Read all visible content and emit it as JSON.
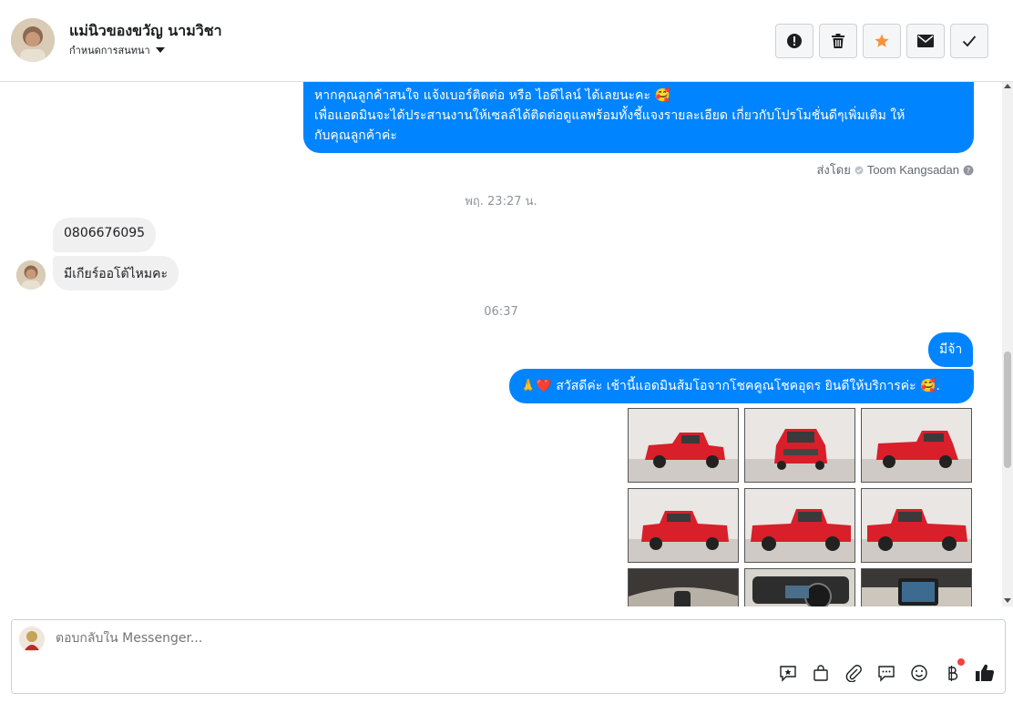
{
  "header": {
    "contact_name": "แม่นิวของขวัญ นามวิชา",
    "assign_label": "กำหนดการสนทนา"
  },
  "icons": {
    "mark_spam": "exclamation-icon",
    "delete": "trash-icon",
    "star": "star-icon",
    "mark_unread": "envelope-icon",
    "done": "checkmark-icon"
  },
  "colors": {
    "outgoing_bubble": "#0084ff",
    "incoming_bubble": "#f1f0f0",
    "star": "#f7923a"
  },
  "messages": {
    "msg1_line1": "หากคุณลูกค้าสนใจ แจ้งเบอร์ติดต่อ หรือ ไอดีไลน์ ได้เลยนะคะ 🥰",
    "msg1_line2": "เพื่อแอดมินจะได้ประสานงานให้เซลล์ได้ติดต่อดูแลพร้อมทั้งชี้แจงรายละเอียด เกี่ยวกับโปรโมชั่นดีๆเพิ่มเติม ให้",
    "msg1_line3": "กับคุณลูกค้าค่ะ",
    "sent_by_label": "ส่งโดย",
    "sent_by_name": "Toom Kangsadan",
    "time1": "พฤ. 23:27 น.",
    "in1": "0806676095",
    "in2": "มีเกียร์ออโต้ไหมคะ",
    "time2": "06:37",
    "out1": "มีจ้า",
    "out2": "🙏❤️ สวัสดีค่ะ เช้านี้แอดมินส้มโอจากโชคคูณโชคอุดร ยินดีให้บริการค่ะ  🥰."
  },
  "photos": [
    {
      "alt": "red pickup front-left"
    },
    {
      "alt": "red pickup front"
    },
    {
      "alt": "red pickup rear-right"
    },
    {
      "alt": "red pickup rear-left"
    },
    {
      "alt": "red pickup side right"
    },
    {
      "alt": "red pickup side left"
    },
    {
      "alt": "interior gear shift"
    },
    {
      "alt": "interior dashboard"
    },
    {
      "alt": "interior console screen"
    }
  ],
  "composer": {
    "placeholder": "ตอบกลับใน Messenger..."
  }
}
